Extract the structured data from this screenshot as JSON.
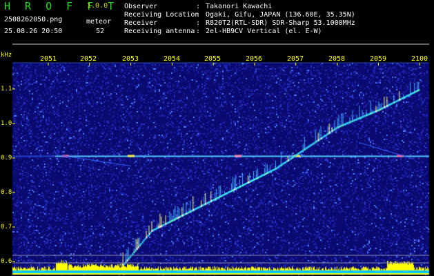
{
  "header": {
    "app_title": "H R O F F T",
    "version": "1.0.0",
    "filename": "2508262050.png",
    "timestamp": "25.08.26 20:50",
    "meteor_label": "meteor",
    "meteor_count": "52"
  },
  "info": [
    {
      "key": "Observer",
      "value": "Takanori Kawachi"
    },
    {
      "key": "Receiving Location",
      "value": "Ogaki, Gifu, JAPAN (136.60E, 35.35N)"
    },
    {
      "key": "Receiver",
      "value": "R820T2(RTL-SDR) SDR-Sharp 53.1000MHz"
    },
    {
      "key": "Receiving antenna",
      "value": "2el-HB9CV Vertical (el. E-W)"
    }
  ],
  "colors": {
    "background": "#000000",
    "noise": "#0a0a70",
    "signal": "#33ddff",
    "label_yellow": "#ffff00",
    "title_green": "#22dd22"
  },
  "chart_data": {
    "type": "heatmap",
    "xlabel": "",
    "ylabel": "kHz",
    "x_ticks": [
      "2051",
      "2052",
      "2053",
      "2054",
      "2055",
      "2056",
      "2057",
      "2058",
      "2059",
      "2100"
    ],
    "y_ticks": [
      "1.1",
      "1.0",
      "0.9",
      "0.8",
      "0.7",
      "0.6"
    ],
    "ylim": [
      0.58,
      1.17
    ],
    "carrier_khz": 0.905,
    "drifting_trace": {
      "minutes": [
        2052.8,
        2053.5,
        2054.5,
        2055.5,
        2056.5,
        2057.0,
        2058.0,
        2059.0,
        2100.0
      ],
      "khz": [
        0.59,
        0.69,
        0.75,
        0.81,
        0.87,
        0.91,
        0.99,
        1.04,
        1.1
      ]
    },
    "grid": false
  }
}
